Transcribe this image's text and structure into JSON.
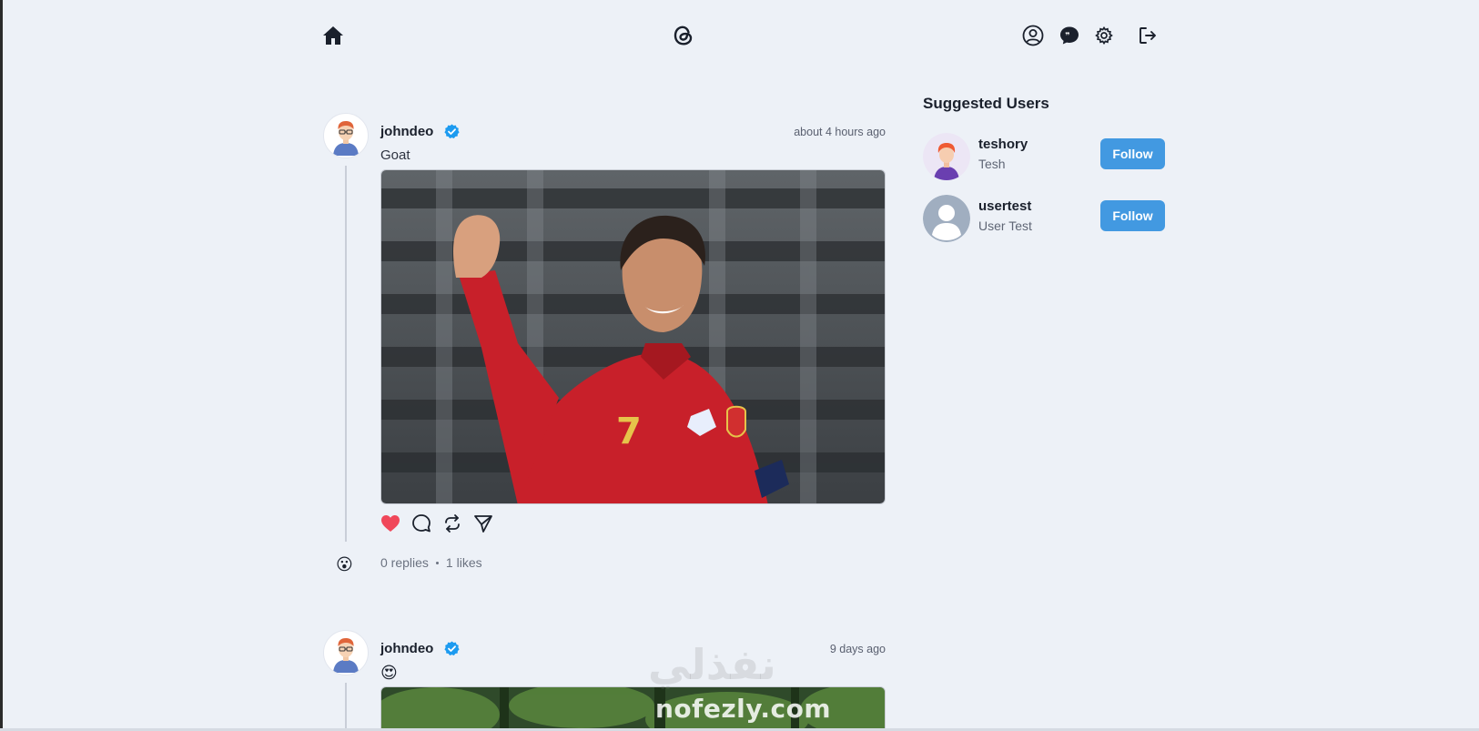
{
  "nav": {
    "home_icon": "home-icon",
    "logo_icon": "threads-logo-icon",
    "profile_icon": "user-circle-icon",
    "chat_icon": "chat-bubble-icon",
    "settings_icon": "gear-icon",
    "logout_icon": "logout-icon"
  },
  "posts": [
    {
      "username": "johndeo",
      "verified": true,
      "time": "about 4 hours ago",
      "text": "Goat",
      "replies": "0 replies",
      "likes": "1 likes",
      "liked": true,
      "reply_emoji": "😮"
    },
    {
      "username": "johndeo",
      "verified": true,
      "time": "9 days ago",
      "text": "😍"
    }
  ],
  "suggested": {
    "title": "Suggested Users",
    "users": [
      {
        "username": "teshory",
        "name": "Tesh",
        "follow_label": "Follow"
      },
      {
        "username": "usertest",
        "name": "User Test",
        "follow_label": "Follow"
      }
    ]
  },
  "watermark": {
    "arabic": "نفذلي",
    "latin": "nofezly.com"
  },
  "colors": {
    "background": "#edf1f7",
    "accent": "#4299e1",
    "like": "#f0475a",
    "verified": "#1d9bf0"
  }
}
